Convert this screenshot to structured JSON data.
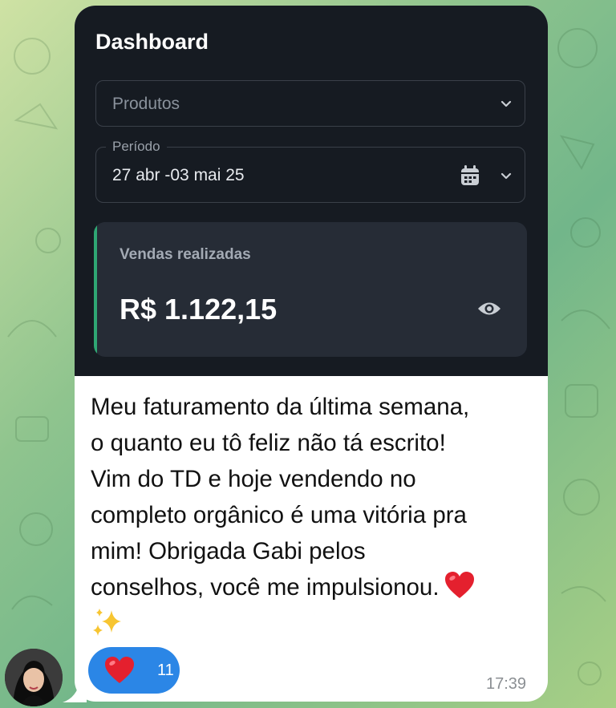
{
  "dashboard": {
    "title": "Dashboard",
    "products_placeholder": "Produtos",
    "period_label": "Período",
    "period_value": "27 abr -03 mai 25",
    "sales_label": "Vendas realizadas",
    "sales_amount": "R$ 1.122,15"
  },
  "message": {
    "lines": [
      "Meu faturamento da última semana,",
      "o quanto eu tô feliz não tá escrito!",
      "Vim do TD e hoje vendendo no",
      "completo orgânico é uma vitória pra",
      "mim! Obrigada Gabi pelos",
      "conselhos, você me impulsionou."
    ],
    "emojis": [
      "❤️",
      "✨"
    ],
    "reaction_emoji": "❤️",
    "reaction_count": "11",
    "time": "17:39"
  },
  "colors": {
    "accent_green": "#2fa774",
    "reaction_blue": "#2b86e6",
    "dashboard_bg": "#161b22",
    "card_bg": "#262c36"
  },
  "icons": [
    "chevron-down-icon",
    "calendar-icon",
    "eye-icon",
    "heart-emoji",
    "sparkles-emoji"
  ]
}
